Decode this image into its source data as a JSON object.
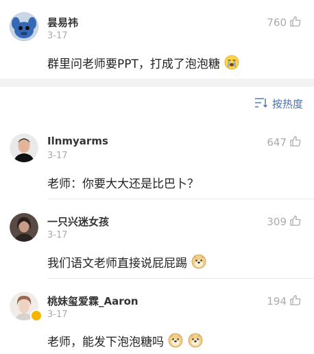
{
  "comments": [
    {
      "name": "昙易祎",
      "date": "3-17",
      "text": "群里问老师要PPT，打成了泡泡糖",
      "likes": "760"
    },
    {
      "name": "Ilnmyarms",
      "date": "3-17",
      "text": "老师：你要大大还是比巴卜？",
      "likes": "647"
    },
    {
      "name": "一只兴迷女孩",
      "date": "3-17",
      "text": "我们语文老师直接说屁屁踢",
      "likes": "309"
    },
    {
      "name": "桃妹玺爱霖_Aaron",
      "date": "3-17",
      "text": "老师，能发下泡泡糖吗",
      "likes": "194"
    }
  ],
  "sort": {
    "label": "按热度"
  },
  "icons": {
    "like": "thumbs-up-icon",
    "sort": "sort-lines-icon",
    "emoji_cry": "crying-emoji",
    "emoji_doge": "doge-emoji"
  }
}
